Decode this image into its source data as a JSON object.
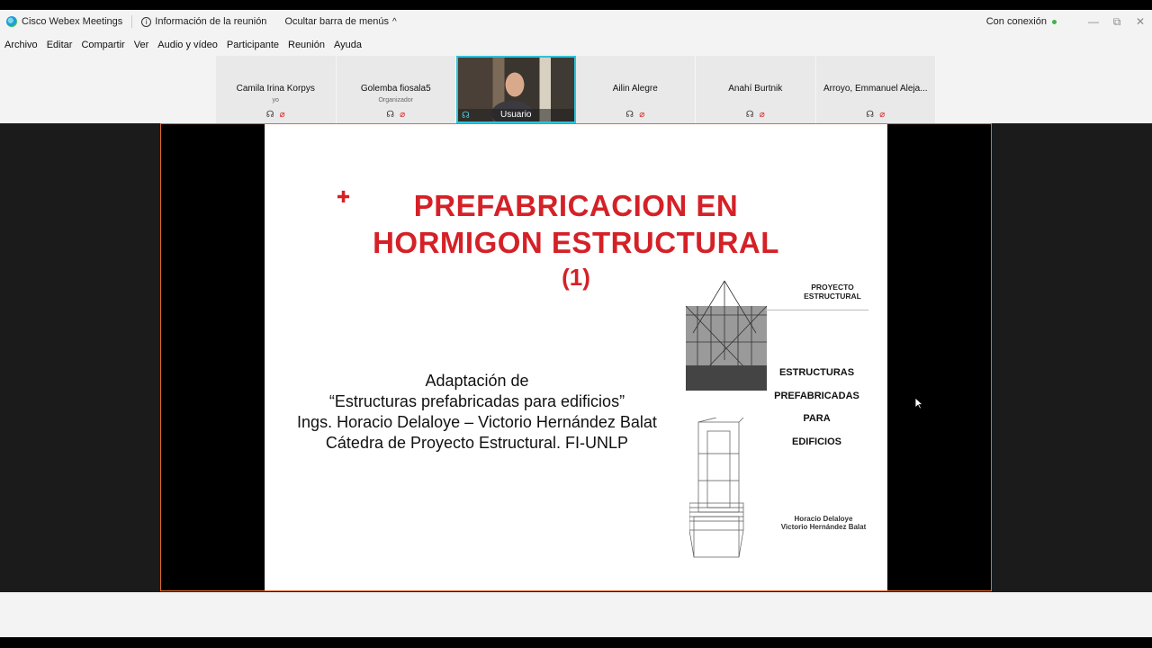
{
  "window": {
    "app_name": "Cisco Webex Meetings",
    "meeting_info": "Información de la reunión",
    "hide_menu": "Ocultar barra de menús",
    "connection_status": "Con conexión",
    "status_color": "#3cb44a",
    "controls": {
      "minimize": "—",
      "restore": "⧉",
      "close": "✕"
    }
  },
  "menu": {
    "items": [
      "Archivo",
      "Editar",
      "Compartir",
      "Ver",
      "Audio y vídeo",
      "Participante",
      "Reunión",
      "Ayuda"
    ]
  },
  "participants": [
    {
      "name": "Camila Irina Korpys",
      "role": "yo"
    },
    {
      "name": "Golemba fiosala5",
      "role": "Organizador"
    },
    {
      "name": "Usuario",
      "role": ""
    },
    {
      "name": "Ailin Alegre",
      "role": ""
    },
    {
      "name": "Anahí Burtnik",
      "role": ""
    },
    {
      "name": "Arroyo, Emmanuel Aleja...",
      "role": ""
    }
  ],
  "slide": {
    "bullet": "✚",
    "title_line1": "PREFABRICACION EN",
    "title_line2": "HORMIGON ESTRUCTURAL",
    "subtitle": "(1)",
    "credits": [
      "Adaptación de",
      "“Estructuras prefabricadas para edificios”",
      "Ings. Horacio Delaloye – Victorio Hernández Balat",
      "Cátedra de Proyecto Estructural. FI-UNLP"
    ],
    "book": {
      "header_line1": "PROYECTO",
      "header_line2": "ESTRUCTURAL",
      "title_lines": [
        "ESTRUCTURAS",
        "PREFABRICADAS",
        "PARA",
        "EDIFICIOS"
      ],
      "author_line1": "Horacio Delaloye",
      "author_line2": "Victorio Hernández Balat"
    }
  },
  "colors": {
    "accent_red": "#d42127",
    "share_border": "#e06a2c",
    "active_speaker": "#2fc2d8"
  }
}
